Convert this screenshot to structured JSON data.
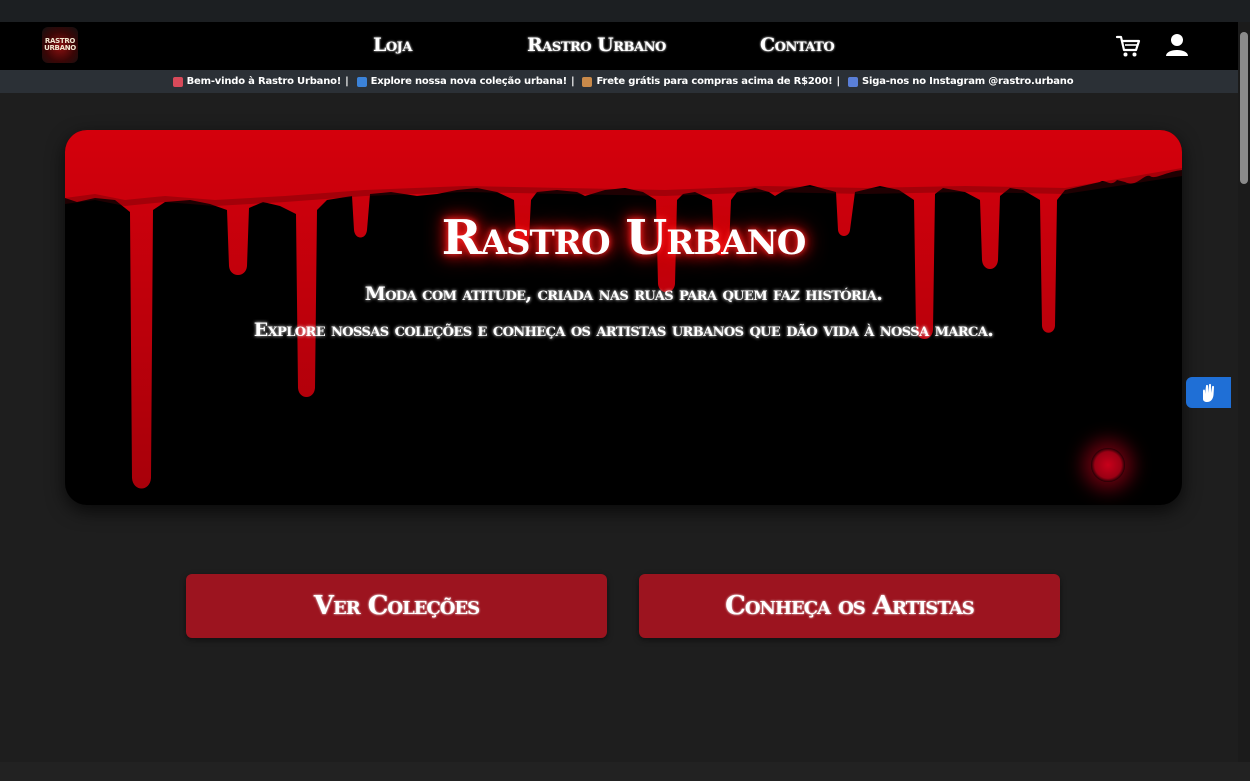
{
  "logo": {
    "line1": "RASTRO",
    "line2": "URBANO"
  },
  "nav": {
    "links": [
      {
        "label": "Loja"
      },
      {
        "label": "Rastro Urbano"
      },
      {
        "label": "Contato"
      }
    ],
    "icons": [
      "cart-icon",
      "user-icon"
    ]
  },
  "ticker": {
    "items": [
      {
        "icon": "rocket-icon",
        "text": "Bem-vindo à Rastro Urbano!"
      },
      {
        "icon": "new-icon",
        "text": "Explore nossa nova coleção urbana!"
      },
      {
        "icon": "package-icon",
        "text": "Frete grátis para compras acima de R$200!"
      },
      {
        "icon": "mobile-icon",
        "text": "Siga-nos no Instagram @rastro.urbano"
      }
    ],
    "separator": "|"
  },
  "hero": {
    "title": "Rastro Urbano",
    "subtitle": "Moda com atitude, criada nas ruas para quem faz história.",
    "description": "Explore nossas coleções e conheça os artistas urbanos que dão vida à nossa marca."
  },
  "buttons": {
    "collections": "Ver Coleções",
    "artists": "Conheça os Artistas"
  },
  "accessibility": {
    "icon": "sign-language-icon"
  },
  "colors": {
    "blood_red": "#c8000f",
    "button_bg": "#9c141f",
    "page_bg": "#1e1e1e",
    "navbar_bg": "#000000",
    "ticker_bg": "#2b3036",
    "accessibility_blue": "#1f6fd6"
  }
}
